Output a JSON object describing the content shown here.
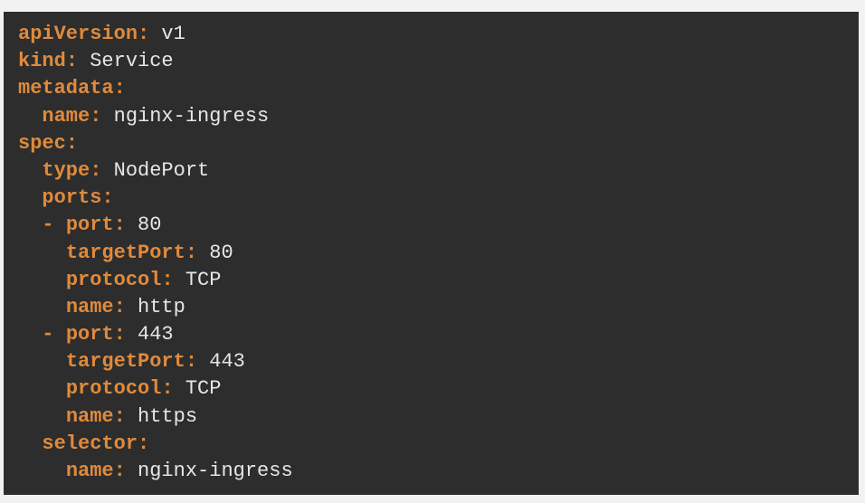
{
  "colors": {
    "background": "#2d2d2d",
    "key": "#e08a3c",
    "value": "#e6e6e6",
    "page": "#f2f2f2"
  },
  "lines": [
    {
      "indent": "",
      "dash": "",
      "key": "apiVersion",
      "value": "v1"
    },
    {
      "indent": "",
      "dash": "",
      "key": "kind",
      "value": "Service"
    },
    {
      "indent": "",
      "dash": "",
      "key": "metadata",
      "value": ""
    },
    {
      "indent": "  ",
      "dash": "",
      "key": "name",
      "value": "nginx-ingress"
    },
    {
      "indent": "",
      "dash": "",
      "key": "spec",
      "value": ""
    },
    {
      "indent": "  ",
      "dash": "",
      "key": "type",
      "value": "NodePort"
    },
    {
      "indent": "  ",
      "dash": "",
      "key": "ports",
      "value": ""
    },
    {
      "indent": "  ",
      "dash": "- ",
      "key": "port",
      "value": "80"
    },
    {
      "indent": "    ",
      "dash": "",
      "key": "targetPort",
      "value": "80"
    },
    {
      "indent": "    ",
      "dash": "",
      "key": "protocol",
      "value": "TCP"
    },
    {
      "indent": "    ",
      "dash": "",
      "key": "name",
      "value": "http"
    },
    {
      "indent": "  ",
      "dash": "- ",
      "key": "port",
      "value": "443"
    },
    {
      "indent": "    ",
      "dash": "",
      "key": "targetPort",
      "value": "443"
    },
    {
      "indent": "    ",
      "dash": "",
      "key": "protocol",
      "value": "TCP"
    },
    {
      "indent": "    ",
      "dash": "",
      "key": "name",
      "value": "https"
    },
    {
      "indent": "  ",
      "dash": "",
      "key": "selector",
      "value": ""
    },
    {
      "indent": "    ",
      "dash": "",
      "key": "name",
      "value": "nginx-ingress"
    }
  ]
}
